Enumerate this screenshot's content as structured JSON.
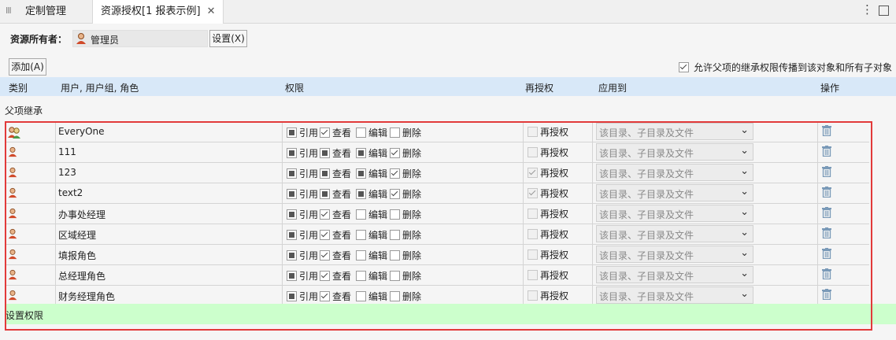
{
  "tabs": [
    {
      "label": "定制管理"
    },
    {
      "label": "资源授权[1 报表示例]"
    }
  ],
  "owner": {
    "label": "资源所有者：",
    "value": "管理员",
    "set_button": "设置(X)"
  },
  "toolbar": {
    "add_button": "添加(A)",
    "inherit_option": "允许父项的继承权限传播到该对象和所有子对象",
    "inherit_checked": true
  },
  "columns": {
    "type": "类别",
    "users": "用户, 用户组, 角色",
    "permissions": "权限",
    "regrant": "再授权",
    "apply_to": "应用到",
    "actions": "操作"
  },
  "section_label": "父项继承",
  "perm_labels": {
    "reference": "引用",
    "view": "查看",
    "edit": "编辑",
    "delete": "删除",
    "regrant": "再授权"
  },
  "rows": [
    {
      "name": "EveryOne",
      "icon": "group-icon",
      "reference": "partial",
      "view": "checked",
      "edit": "unchecked",
      "delete": "unchecked",
      "regrant": false,
      "apply_to": "该目录、子目录及文件"
    },
    {
      "name": "111",
      "icon": "user-icon",
      "reference": "partial",
      "view": "partial",
      "edit": "partial",
      "delete": "checked",
      "regrant": false,
      "apply_to": "该目录、子目录及文件"
    },
    {
      "name": "123",
      "icon": "user-icon",
      "reference": "partial",
      "view": "partial",
      "edit": "partial",
      "delete": "checked",
      "regrant": true,
      "apply_to": "该目录、子目录及文件"
    },
    {
      "name": "text2",
      "icon": "user-icon",
      "reference": "partial",
      "view": "partial",
      "edit": "partial",
      "delete": "checked",
      "regrant": true,
      "apply_to": "该目录、子目录及文件"
    },
    {
      "name": "办事处经理",
      "icon": "user-icon",
      "reference": "partial",
      "view": "checked",
      "edit": "unchecked",
      "delete": "unchecked",
      "regrant": false,
      "apply_to": "该目录、子目录及文件"
    },
    {
      "name": "区域经理",
      "icon": "user-icon",
      "reference": "partial",
      "view": "checked",
      "edit": "unchecked",
      "delete": "unchecked",
      "regrant": false,
      "apply_to": "该目录、子目录及文件"
    },
    {
      "name": "填报角色",
      "icon": "user-icon",
      "reference": "partial",
      "view": "checked",
      "edit": "unchecked",
      "delete": "unchecked",
      "regrant": false,
      "apply_to": "该目录、子目录及文件"
    },
    {
      "name": "总经理角色",
      "icon": "user-icon",
      "reference": "partial",
      "view": "checked",
      "edit": "unchecked",
      "delete": "unchecked",
      "regrant": false,
      "apply_to": "该目录、子目录及文件"
    },
    {
      "name": "财务经理角色",
      "icon": "user-icon",
      "reference": "partial",
      "view": "checked",
      "edit": "unchecked",
      "delete": "unchecked",
      "regrant": false,
      "apply_to": "该目录、子目录及文件"
    }
  ],
  "footer_label": "设置权限",
  "colors": {
    "header_bg": "#d8e8f8",
    "footer_bg": "#ccffcc",
    "highlight_border": "#e23a3a"
  }
}
